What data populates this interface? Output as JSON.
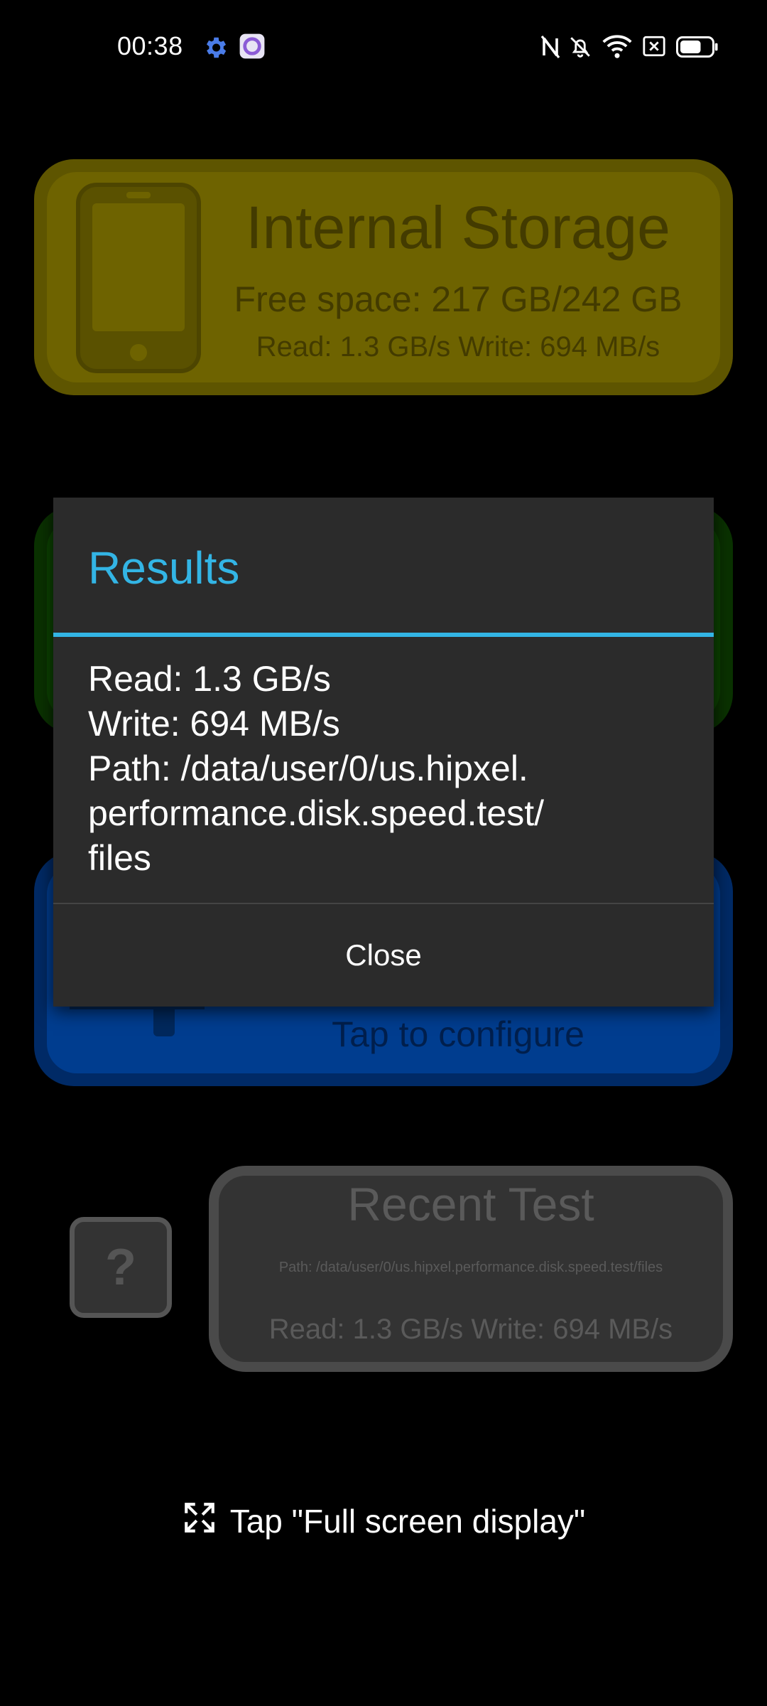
{
  "status_bar": {
    "time": "00:38",
    "icons": [
      "gear-icon",
      "app-icon",
      "nfc-icon",
      "bell-muted-icon",
      "wifi-icon",
      "sim-x-icon",
      "battery-icon"
    ],
    "battery_level": 0.65
  },
  "storage_card": {
    "title": "Internal Storage",
    "free_space": "Free space: 217 GB/242 GB",
    "speed": "Read: 1.3 GB/s Write: 694 MB/s"
  },
  "config_card": {
    "hint": "Tap to configure"
  },
  "help_button": {
    "label": "?"
  },
  "recent_test": {
    "title": "Recent Test",
    "path": "Path: /data/user/0/us.hipxel.performance.disk.speed.test/files",
    "speed": "Read: 1.3 GB/s Write: 694 MB/s"
  },
  "dialog": {
    "title": "Results",
    "lines": [
      "Read: 1.3 GB/s",
      "Write: 694 MB/s",
      "Path: /data/user/0/us.hipxel.",
      "performance.disk.speed.test/",
      "files"
    ],
    "close_label": "Close"
  },
  "fullscreen_hint": {
    "label": "Tap \"Full screen display\""
  },
  "colors": {
    "accent": "#33b5e5",
    "storage_card": "#6e6300",
    "config_card": "#0c4400",
    "blue_card": "#003d8f",
    "dialog_bg": "#2b2b2b"
  }
}
